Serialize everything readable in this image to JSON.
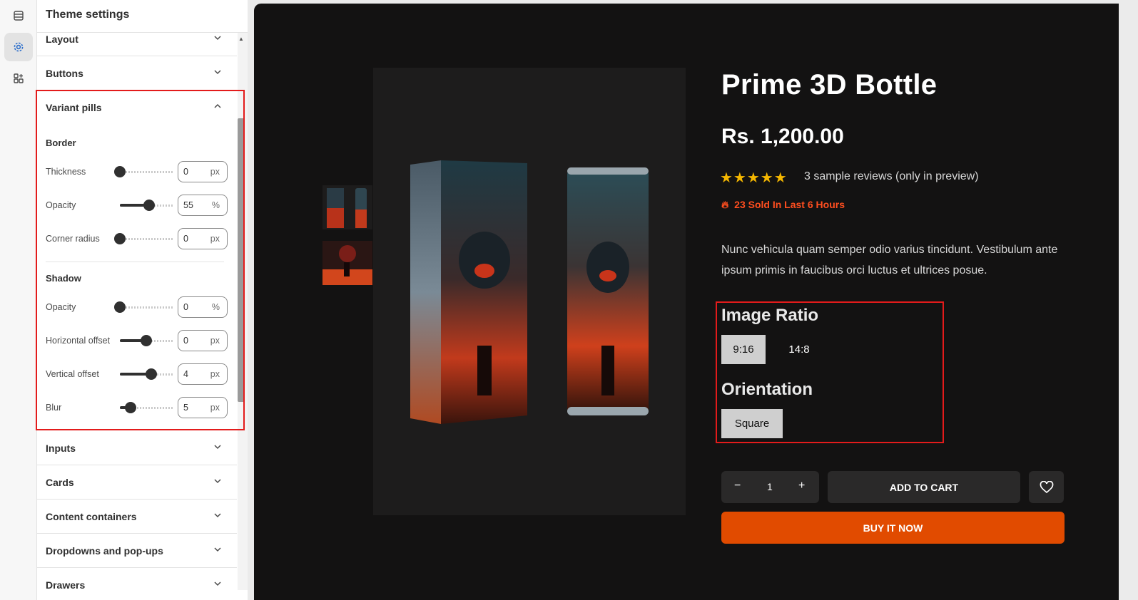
{
  "editor": {
    "title": "Theme settings",
    "sections_top": [
      {
        "label": "Layout"
      },
      {
        "label": "Buttons"
      }
    ],
    "variant_pills": {
      "label": "Variant pills",
      "border": {
        "heading": "Border",
        "thickness": {
          "label": "Thickness",
          "value": "0",
          "unit": "px",
          "level": 0.0
        },
        "opacity": {
          "label": "Opacity",
          "value": "55",
          "unit": "%",
          "level": 0.55
        },
        "corner_radius": {
          "label": "Corner radius",
          "value": "0",
          "unit": "px",
          "level": 0.0
        }
      },
      "shadow": {
        "heading": "Shadow",
        "opacity": {
          "label": "Opacity",
          "value": "0",
          "unit": "%",
          "level": 0.0
        },
        "horizontal_offset": {
          "label": "Horizontal offset",
          "value": "0",
          "unit": "px",
          "level": 0.5
        },
        "vertical_offset": {
          "label": "Vertical offset",
          "value": "4",
          "unit": "px",
          "level": 0.6
        },
        "blur": {
          "label": "Blur",
          "value": "5",
          "unit": "px",
          "level": 0.2
        }
      }
    },
    "sections_bottom": [
      {
        "label": "Inputs"
      },
      {
        "label": "Cards"
      },
      {
        "label": "Content containers"
      },
      {
        "label": "Dropdowns and pop-ups"
      },
      {
        "label": "Drawers"
      }
    ],
    "rail_icons": [
      "sections-icon",
      "settings-gear-icon",
      "apps-icon"
    ]
  },
  "product": {
    "title": "Prime 3D Bottle",
    "price": "Rs. 1,200.00",
    "rating_stars": "★★★★★",
    "reviews": "3 sample reviews (only in preview)",
    "sold": "23 Sold In Last 6 Hours",
    "description": "Nunc vehicula quam semper odio varius tincidunt. Vestibulum ante ipsum primis in faucibus orci luctus et ultrices posue.",
    "image_ratio_label": "Image Ratio",
    "image_ratio_options": [
      "9:16",
      "14:8"
    ],
    "image_ratio_selected": "9:16",
    "orientation_label": "Orientation",
    "orientation_options": [
      "Square"
    ],
    "quantity": "1",
    "minus": "−",
    "plus": "+",
    "add_to_cart": "ADD TO CART",
    "buy_now": "BUY IT NOW"
  },
  "colors": {
    "highlight": "#e31b1b",
    "accent": "#e14b00",
    "sold": "#ff4e1f",
    "star": "#f5b700",
    "preview_bg": "#131212"
  }
}
